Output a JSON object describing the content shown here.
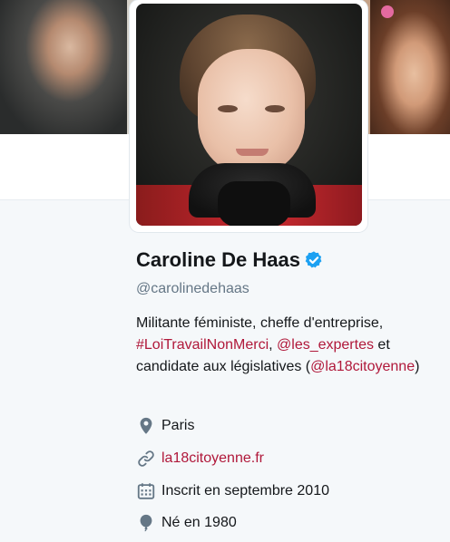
{
  "profile": {
    "name": "Caroline De Haas",
    "handle": "@carolinedehaas",
    "bio": {
      "text1": "Militante féministe, cheffe d'entreprise, ",
      "hashtag": "#LoiTravailNonMerci",
      "sep": ", ",
      "mention1": "@les_expertes",
      "text2": " et candidate aux législatives (",
      "mention2": "@la18citoyenne",
      "text3": ")"
    },
    "location": "Paris",
    "website": "la18citoyenne.fr",
    "joined": "Inscrit en septembre 2010",
    "birth": "Né en 1980"
  },
  "colors": {
    "link": "#b0183a",
    "verified": "#1da1f2",
    "icon": "#657786"
  },
  "icons": {
    "verified": "verified-badge-icon",
    "location": "location-pin-icon",
    "website": "link-icon",
    "joined": "calendar-icon",
    "birth": "balloon-icon"
  }
}
